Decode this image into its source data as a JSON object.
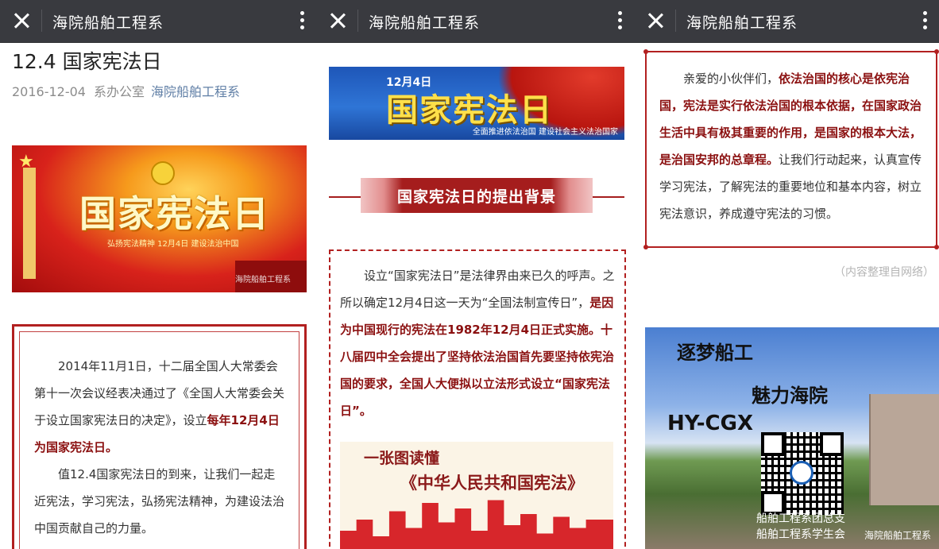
{
  "topbar": {
    "title": "海院船舶工程系"
  },
  "article": {
    "title": "12.4 国家宪法日",
    "date": "2016-12-04",
    "author": "系办公室",
    "account": "海院船舶工程系"
  },
  "banner1": {
    "heading": "国家宪法日",
    "sub": "弘扬宪法精神 12月4日 建设法治中国",
    "watermark": "海院船舶工程系"
  },
  "box1": {
    "p1_a": "2014年11月1日，十二届全国人大常委会第十一次会议经表决通过了《全国人大常委会关于设立国家宪法日的决定》，设立",
    "p1_b": "每年12月4日为国家宪法日。",
    "p2": "值12.4国家宪法日的到来，让我们一起走近宪法，学习宪法，弘扬宪法精神，为建设法治中国贡献自己的力量。"
  },
  "banner2": {
    "date": "12月4日",
    "heading": "国家宪法日",
    "slogan": "全面推进依法治国 建设社会主义法治国家"
  },
  "section": {
    "title": "国家宪法日的提出背景"
  },
  "box2": {
    "a": "设立“国家宪法日”是法律界由来已久的呼声。之所以确定12月4日这一天为“全国法制宣传日”，",
    "b": "是因为中国现行的宪法在1982年12月4日正式实施。十八届四中全会提出了坚持依法治国首先要坚持依宪治国的要求，全国人大便拟以立法形式设立“国家宪法日”。"
  },
  "poster": {
    "line1": "一张图读懂",
    "line2": "《中华人民共和国宪法》"
  },
  "box3": {
    "a": "亲爱的小伙伴们，",
    "b": "依法治国的核心是依宪治国，宪法是实行依法治国的根本依据，在国家政治生活中具有极其重要的作用，是国家的根本大法，是治国安邦的总章程。",
    "c": "让我们行动起来，认真宣传学习宪法，了解宪法的重要地位和基本内容，树立宪法意识，养成遵守宪法的习惯。"
  },
  "note": "（内容整理自网络）",
  "photo": {
    "t1": "逐梦船工",
    "t2": "魅力海院",
    "t3": "HY-CGX",
    "cap1": "船舶工程系团总支",
    "cap2": "船舶工程系学生会",
    "watermark": "海院船舶工程系"
  },
  "icons": {
    "close": "close-icon",
    "more": "more-vertical-icon"
  }
}
